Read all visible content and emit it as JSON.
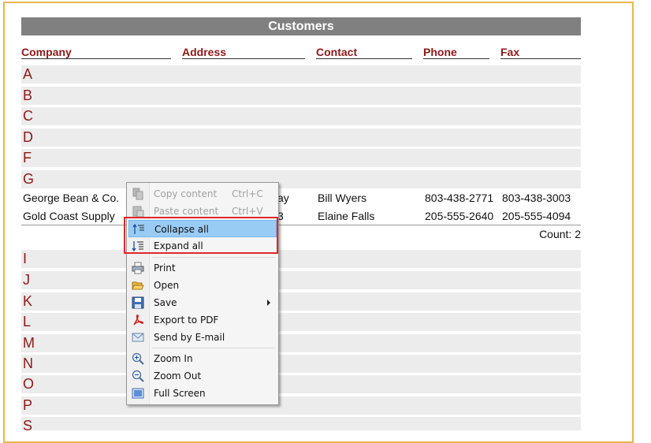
{
  "report": {
    "title": "Customers",
    "columns": [
      "Company",
      "Address",
      "Contact",
      "Phone",
      "Fax"
    ],
    "letters_top": [
      "A",
      "B",
      "C",
      "D",
      "F",
      "G"
    ],
    "rows": [
      {
        "company": "George Bean & Co.",
        "address_tail": "ay",
        "contact": "Bill Wyers",
        "phone": "803-438-2771",
        "fax": "803-438-3003"
      },
      {
        "company": "Gold Coast Supply",
        "address_tail": "3",
        "contact": "Elaine Falls",
        "phone": "205-555-2640",
        "fax": "205-555-4094"
      }
    ],
    "count_label": "Count: 2",
    "letters_bottom": [
      "I",
      "J",
      "K",
      "L",
      "M",
      "N",
      "O",
      "P",
      "S"
    ]
  },
  "context_menu": {
    "copy": {
      "label": "Copy content",
      "shortcut": "Ctrl+C",
      "icon": "copy-icon"
    },
    "paste": {
      "label": "Paste content",
      "shortcut": "Ctrl+V",
      "icon": "paste-icon"
    },
    "collapse": {
      "label": "Collapse all",
      "icon": "collapse-all-icon"
    },
    "expand": {
      "label": "Expand all",
      "icon": "expand-all-icon"
    },
    "print": {
      "label": "Print",
      "icon": "printer-icon"
    },
    "open": {
      "label": "Open",
      "icon": "folder-open-icon"
    },
    "save": {
      "label": "Save",
      "icon": "floppy-disk-icon"
    },
    "export_pdf": {
      "label": "Export to PDF",
      "icon": "pdf-icon"
    },
    "email": {
      "label": "Send by E-mail",
      "icon": "envelope-icon"
    },
    "zoom_in": {
      "label": "Zoom In",
      "icon": "zoom-in-icon"
    },
    "zoom_out": {
      "label": "Zoom Out",
      "icon": "zoom-out-icon"
    },
    "full_screen": {
      "label": "Full Screen",
      "icon": "full-screen-icon"
    }
  },
  "colors": {
    "header_bg": "#808080",
    "letter_color": "#8b1a1a",
    "highlight": "#99ccf5",
    "callout": "#e0262b",
    "frame": "#e8b84a"
  }
}
